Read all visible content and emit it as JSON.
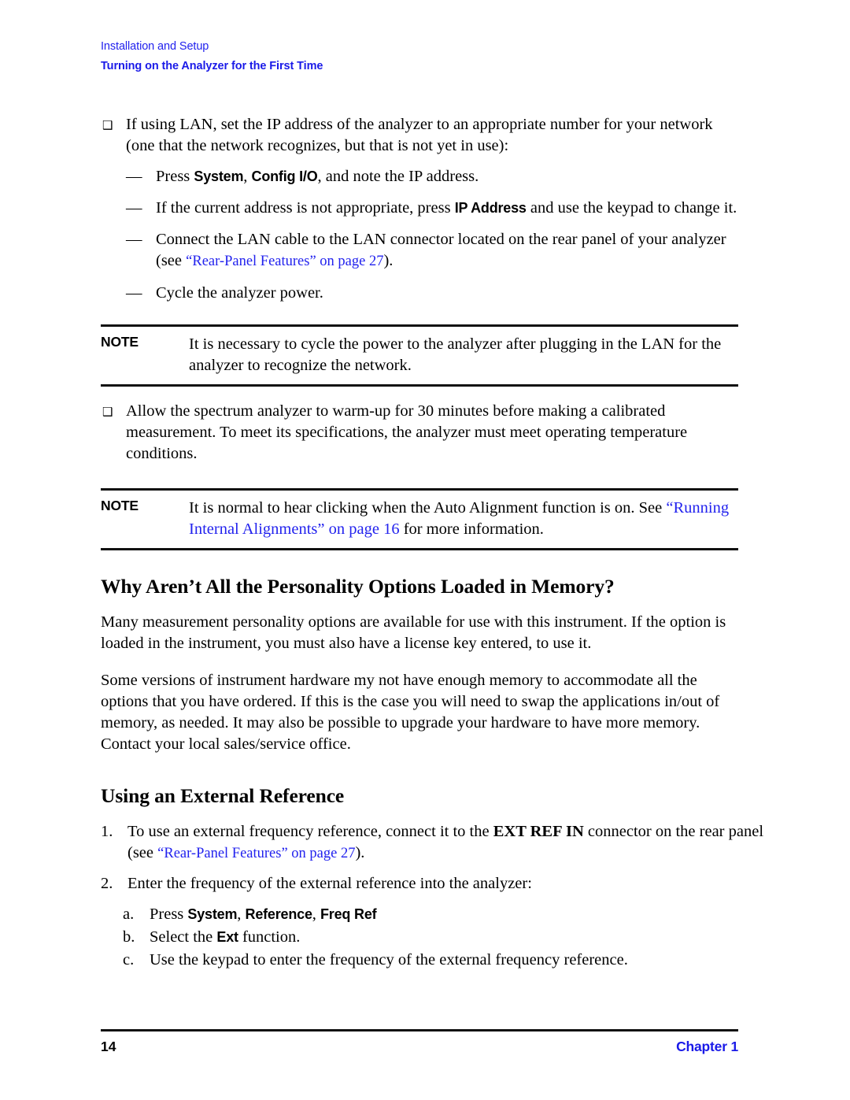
{
  "header": {
    "book_section": "Installation and Setup",
    "topic": "Turning on the Analyzer for the First Time"
  },
  "colors": {
    "link_blue": "#2222ee",
    "header_blue": "#1a1ae8",
    "text_black": "#000000",
    "rule_black": "#111111"
  },
  "icons": {
    "bullet_square": "❑",
    "em_dash": "—"
  },
  "content": {
    "bullet1": {
      "text_a": "If using LAN, set the IP address of the analyzer to an appropriate number for your network (one that the network recognizes, but that is not yet in use):",
      "sub": [
        {
          "pre": "Press ",
          "key1": "System",
          "mid1": ", ",
          "key2": "Config I/O",
          "post": ", and note the IP address."
        },
        {
          "pre": "If the current address is not appropriate, press ",
          "key1": "IP Address",
          "post": " and use the keypad to change it."
        },
        {
          "pre": "Connect the LAN cable to the LAN connector located on the rear panel of your analyzer (see ",
          "link": "“Rear-Panel Features” on page 27",
          "post": ")."
        },
        {
          "pre": "Cycle the analyzer power."
        }
      ]
    },
    "note1": {
      "label": "NOTE",
      "text": "It is necessary to cycle the power to the analyzer after plugging in the LAN for the analyzer to recognize the network."
    },
    "bullet2": {
      "text_a": "Allow the spectrum analyzer to warm-up for 30 minutes before making a calibrated measurement. To meet its specifications, the analyzer must meet operating temperature conditions."
    },
    "note2": {
      "label": "NOTE",
      "pre": "It is normal to hear clicking when the Auto Alignment function is on. See ",
      "link": "“Running Internal Alignments” on page 16",
      "post": " for more information."
    },
    "section1": {
      "heading": "Why Aren’t All the Personality Options Loaded in Memory?",
      "para1": "Many measurement personality options are available for use with this instrument. If the option is loaded in the instrument, you must also have a license key entered, to use it.",
      "para2": "Some versions of instrument hardware my not have enough memory to accommodate all the options that you have ordered. If this is the case you will need to swap the applications in/out of memory, as needed. It may also be possible to upgrade your hardware to have more memory. Contact your local sales/service office."
    },
    "section2": {
      "heading": "Using an External Reference",
      "step1": {
        "marker": "1.",
        "pre": "To use an external frequency reference, connect it to the ",
        "key1": "EXT REF IN",
        "mid": " connector on the rear panel (see ",
        "link": "“Rear-Panel Features” on page 27",
        "post": ")."
      },
      "step2": {
        "marker": "2.",
        "text": "Enter the frequency of the external reference into the analyzer:"
      },
      "substeps": [
        {
          "marker": "a.",
          "pre": "Press ",
          "key1": "System",
          "mid1": ", ",
          "key2": "Reference",
          "mid2": ", ",
          "key3": "Freq Ref",
          "post": ""
        },
        {
          "marker": "b.",
          "pre": "Select the ",
          "key1": "Ext",
          "post": " function."
        },
        {
          "marker": "c.",
          "pre": "Use the keypad to enter the frequency of the external frequency reference.",
          "post": ""
        }
      ]
    }
  },
  "footer": {
    "page_number": "14",
    "chapter": "Chapter 1"
  }
}
